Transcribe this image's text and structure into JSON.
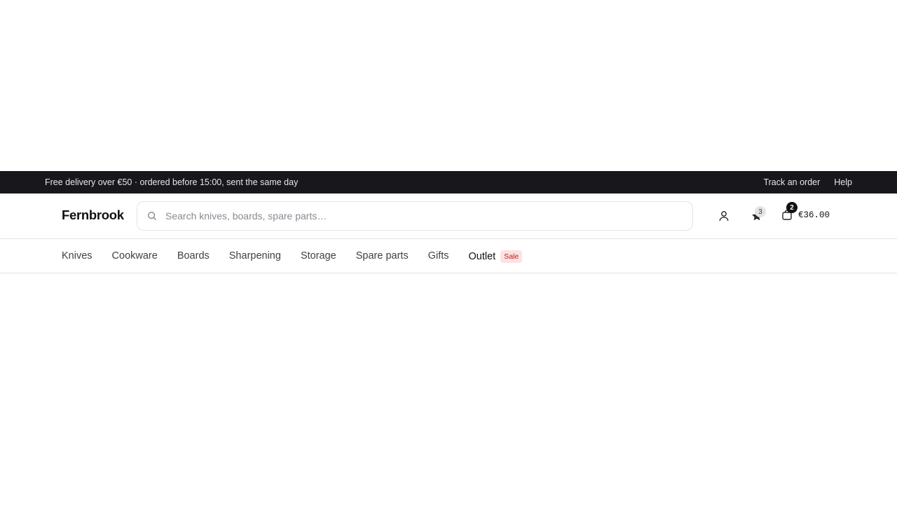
{
  "announcement": {
    "text": "Free delivery over €50 · ordered before 15:00, sent the same day",
    "links": [
      {
        "label": "Track an order"
      },
      {
        "label": "Help"
      }
    ]
  },
  "header": {
    "logo": "Fernbrook",
    "search": {
      "placeholder": "Search knives, boards, spare parts…",
      "value": ""
    },
    "icons": {
      "account": "user-icon",
      "wishlist": "star-icon",
      "cart": "bag-icon"
    },
    "wishlist_count": "3",
    "cart_count": "2",
    "cart_total": "€36.00"
  },
  "nav": {
    "items": [
      {
        "label": "Knives"
      },
      {
        "label": "Cookware"
      },
      {
        "label": "Boards"
      },
      {
        "label": "Sharpening"
      },
      {
        "label": "Storage"
      },
      {
        "label": "Spare parts"
      },
      {
        "label": "Gifts"
      }
    ],
    "outlet": {
      "label": "Outlet",
      "badge": "Sale"
    }
  },
  "colors": {
    "announce_bg": "#18171b",
    "sale_badge_bg": "#fde2e2",
    "sale_badge_text": "#b91c1c"
  }
}
